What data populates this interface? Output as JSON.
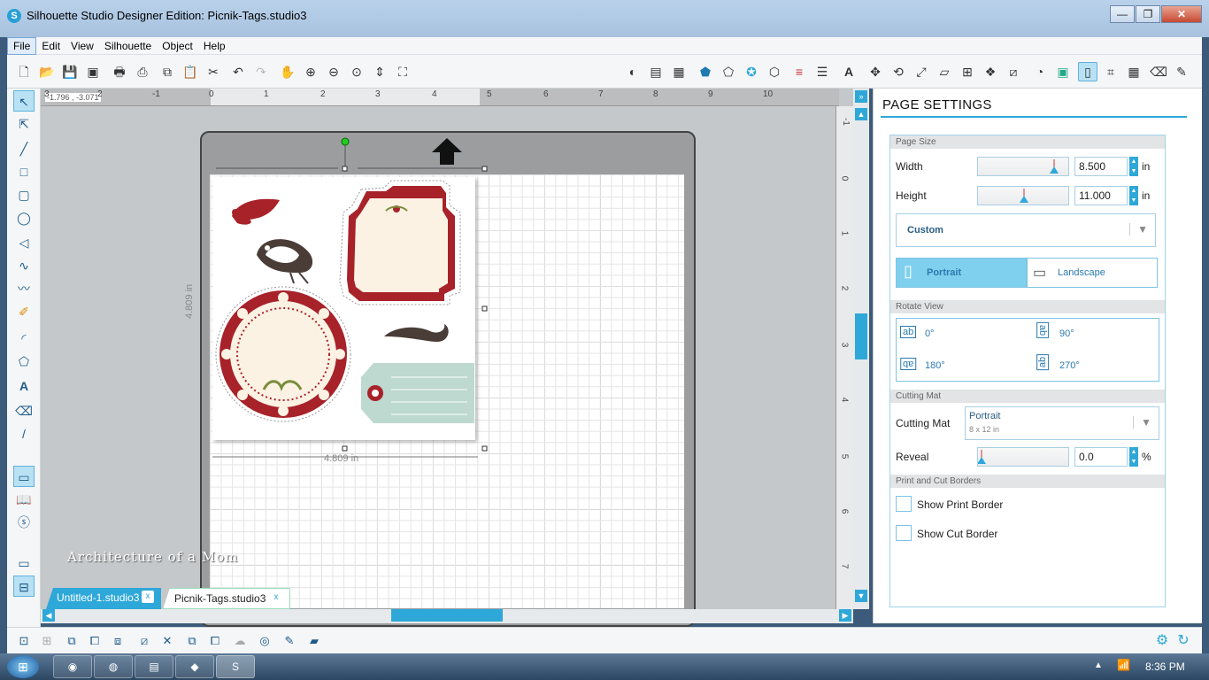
{
  "window": {
    "title": "Silhouette Studio Designer Edition: Picnik-Tags.studio3",
    "min": "—",
    "max": "❐",
    "close": "✕"
  },
  "menu": [
    "File",
    "Edit",
    "View",
    "Silhouette",
    "Object",
    "Help"
  ],
  "ruler": {
    "coords": "-1.796 , -3.071",
    "h_labels": [
      "3",
      "2",
      "-1",
      "0",
      "1",
      "2",
      "3",
      "4",
      "5",
      "6",
      "7",
      "8",
      "9",
      "10"
    ],
    "v_labels": [
      "-1",
      "0",
      "1",
      "2",
      "3",
      "4",
      "5",
      "6",
      "7"
    ]
  },
  "canvas": {
    "dim_vertical": "4.809 in",
    "dim_horizontal": "4.809 in"
  },
  "tabs": [
    {
      "label": "Untitled-1.studio3",
      "close": "x"
    },
    {
      "label": "Picnik-Tags.studio3",
      "close": "x"
    }
  ],
  "watermark": "Architecture of a Mom",
  "panel": {
    "title": "PAGE SETTINGS",
    "page_size": {
      "header": "Page Size",
      "width_label": "Width",
      "width_value": "8.500",
      "width_unit": "in",
      "height_label": "Height",
      "height_value": "11.000",
      "height_unit": "in",
      "preset": "Custom",
      "portrait": "Portrait",
      "landscape": "Landscape"
    },
    "rotate": {
      "header": "Rotate View",
      "r0": "0°",
      "r90": "90°",
      "r180": "180°",
      "r270": "270°"
    },
    "cutting_mat": {
      "header": "Cutting Mat",
      "label": "Cutting Mat",
      "value": "Portrait",
      "sub": "8 x 12 in",
      "reveal_label": "Reveal",
      "reveal_value": "0.0",
      "reveal_unit": "%"
    },
    "borders": {
      "header": "Print and Cut Borders",
      "print": "Show Print Border",
      "cut": "Show Cut Border"
    }
  },
  "taskbar": {
    "time": "8:36 PM"
  },
  "colors": {
    "accent": "#2ea8d8",
    "tag_red": "#a8222a",
    "tag_cream": "#fbf2e4",
    "tag_mint": "#bdd9d0"
  }
}
